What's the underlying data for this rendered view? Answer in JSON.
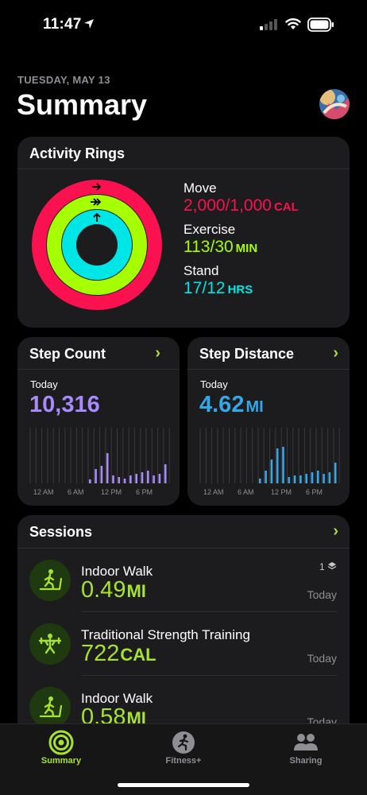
{
  "status": {
    "time": "11:47"
  },
  "header": {
    "date": "TUESDAY, MAY 13",
    "title": "Summary"
  },
  "activity": {
    "title": "Activity Rings",
    "move": {
      "label": "Move",
      "value": "2,000/1,000",
      "unit": "CAL",
      "color": "#fa114f"
    },
    "exercise": {
      "label": "Exercise",
      "value": "113/30",
      "unit": "MIN",
      "color": "#a6ff00"
    },
    "stand": {
      "label": "Stand",
      "value": "17/12",
      "unit": "HRS",
      "color": "#00e5e6"
    }
  },
  "step_count": {
    "title": "Step Count",
    "period": "Today",
    "value": "10,316",
    "color": "#a78bfa",
    "axis": [
      "12 AM",
      "6 AM",
      "12 PM",
      "6 PM"
    ]
  },
  "step_distance": {
    "title": "Step Distance",
    "period": "Today",
    "value": "4.62",
    "unit": "MI",
    "color": "#34a7e8",
    "axis": [
      "12 AM",
      "6 AM",
      "12 PM",
      "6 PM"
    ]
  },
  "sessions": {
    "title": "Sessions",
    "items": [
      {
        "name": "Indoor Walk",
        "value": "0.49",
        "unit": "MI",
        "date": "Today",
        "badge": "1"
      },
      {
        "name": "Traditional Strength Training",
        "value": "722",
        "unit": "CAL",
        "date": "Today"
      },
      {
        "name": "Indoor Walk",
        "value": "0.58",
        "unit": "MI",
        "date": "Today"
      }
    ]
  },
  "tabs": [
    {
      "label": "Summary",
      "icon": "summary-rings-icon",
      "active": true
    },
    {
      "label": "Fitness+",
      "icon": "fitness-plus-icon",
      "active": false
    },
    {
      "label": "Sharing",
      "icon": "sharing-people-icon",
      "active": false
    }
  ],
  "accent": "#a7e22e"
}
